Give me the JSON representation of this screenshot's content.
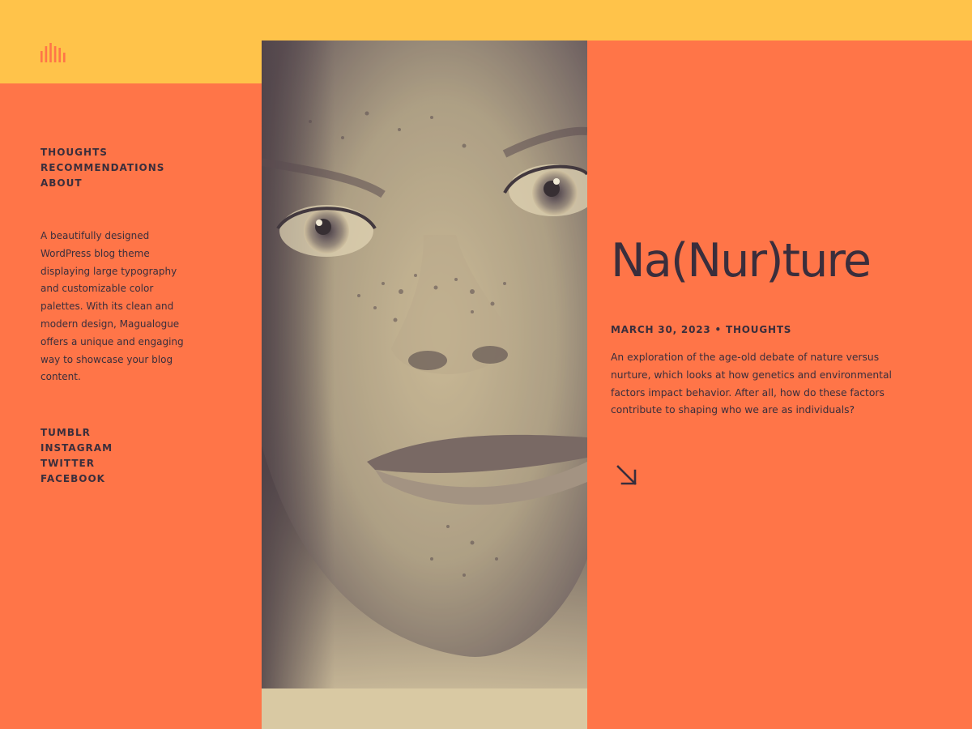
{
  "theme": {
    "background": "#FF7548",
    "accent": "#FFC34A",
    "text": "#3A2E3C",
    "photo_tint": "#D9C9A3"
  },
  "logo": {
    "icon": "bars-logo-icon"
  },
  "nav": {
    "items": [
      "THOUGHTS",
      "RECOMMENDATIONS",
      "ABOUT"
    ]
  },
  "tagline": "A beautifully designed WordPress blog theme displaying large typography and customizable color palettes. With its clean and modern design, Magualogue offers a unique and engaging way to showcase your blog content.",
  "social": {
    "items": [
      "TUMBLR",
      "INSTAGRAM",
      "TWITTER",
      "FACEBOOK"
    ]
  },
  "post": {
    "title": "Na(Nur)ture",
    "meta": "MARCH 30, 2023 • THOUGHTS",
    "excerpt": "An exploration of the age-old debate of nature versus nurture, which looks at how genetics and environmental factors impact behavior. After all, how do these factors contribute to shaping who we are as individuals?",
    "link_icon": "arrow-down-right-icon"
  }
}
